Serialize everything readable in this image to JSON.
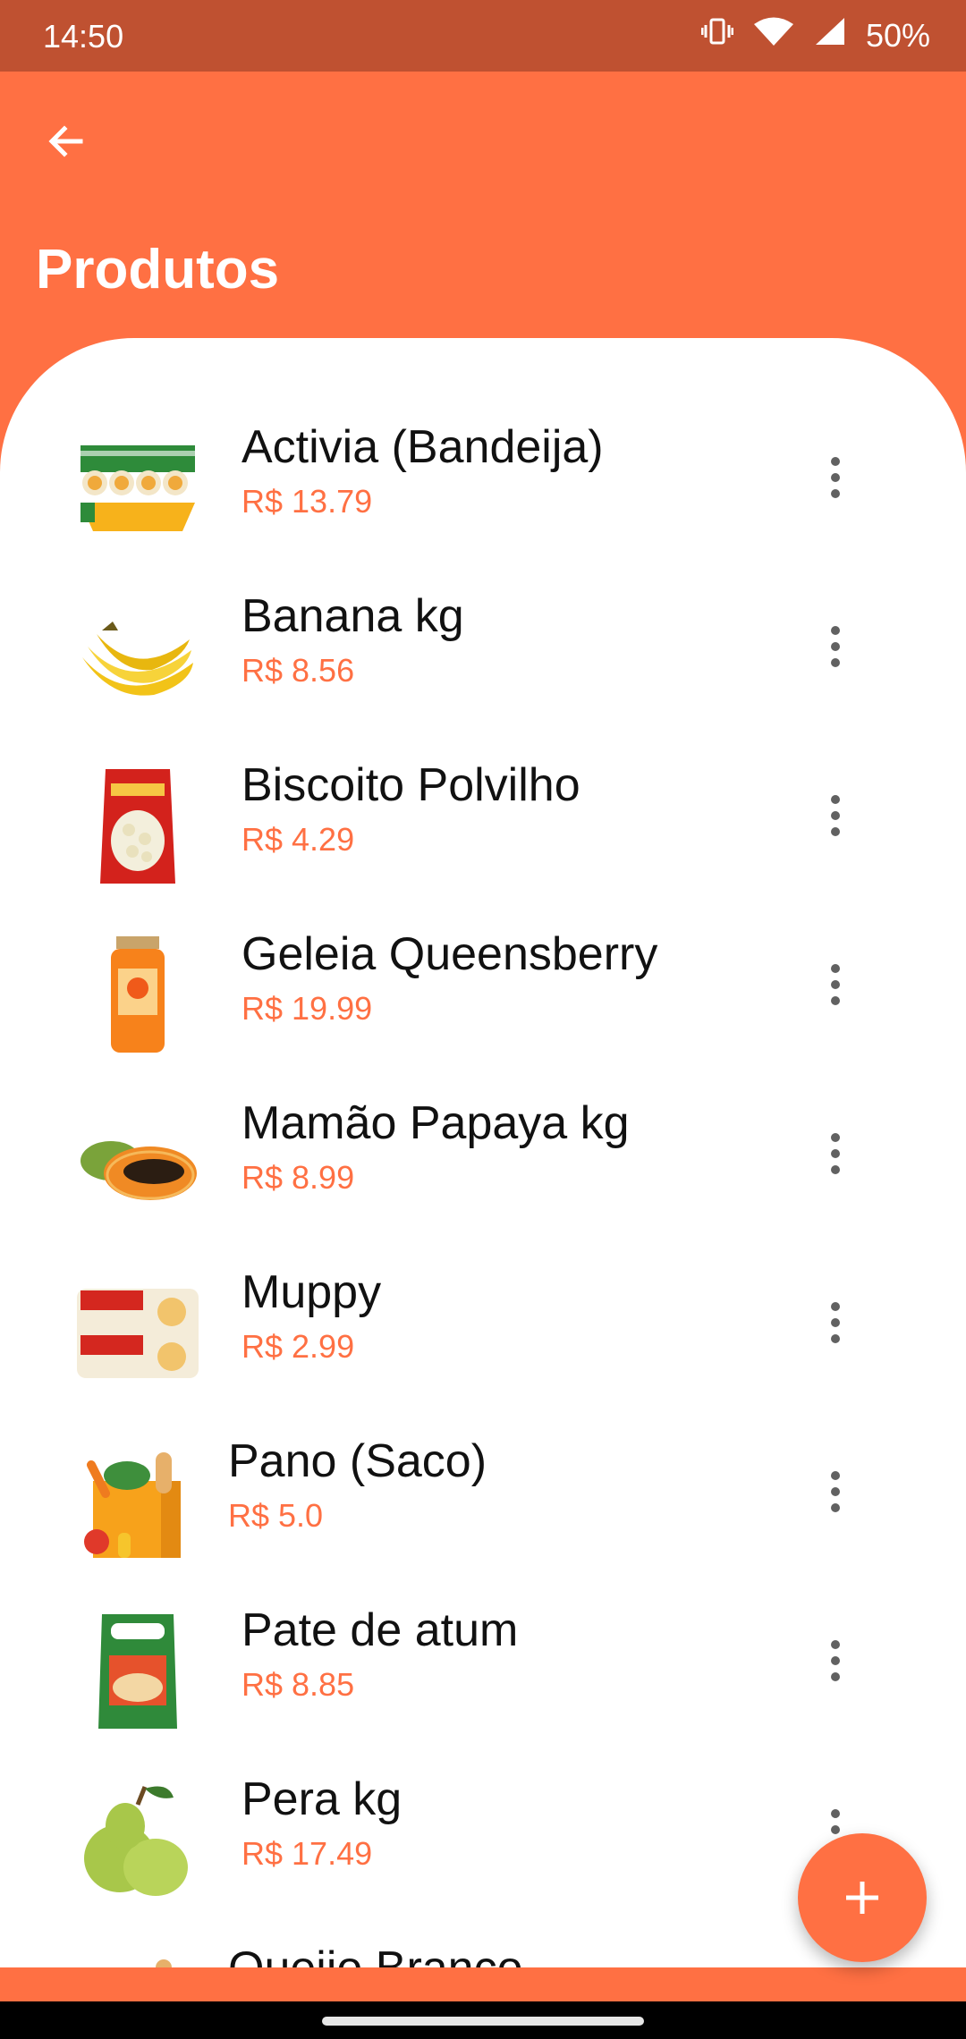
{
  "status_bar": {
    "time": "14:50",
    "battery": "50%"
  },
  "header": {
    "title": "Produtos"
  },
  "products": [
    {
      "name": "Activia (Bandeija)",
      "price": "R$ 13.79",
      "image": "activia-yogurt-tray"
    },
    {
      "name": "Banana kg",
      "price": "R$ 8.56",
      "image": "bananas"
    },
    {
      "name": "Biscoito Polvilho",
      "price": "R$ 4.29",
      "image": "cassini-biscuit-bag"
    },
    {
      "name": "Geleia Queensberry",
      "price": "R$ 19.99",
      "image": "jam-jar"
    },
    {
      "name": "Mamão Papaya kg",
      "price": "R$ 8.99",
      "image": "papaya"
    },
    {
      "name": "Muppy",
      "price": "R$ 2.99",
      "image": "mupy-box"
    },
    {
      "name": "Pano (Saco)",
      "price": "R$ 5.0",
      "image": "grocery-bag-placeholder"
    },
    {
      "name": "Pate de atum",
      "price": "R$ 8.85",
      "image": "tuna-pate-pouch"
    },
    {
      "name": "Pera kg",
      "price": "R$ 17.49",
      "image": "pears"
    },
    {
      "name": "Queijo Branco",
      "price": "",
      "image": "grocery-bag-placeholder"
    }
  ],
  "colors": {
    "primary": "#ff7043",
    "status_bar": "#bf5131",
    "price": "#ff7043"
  }
}
